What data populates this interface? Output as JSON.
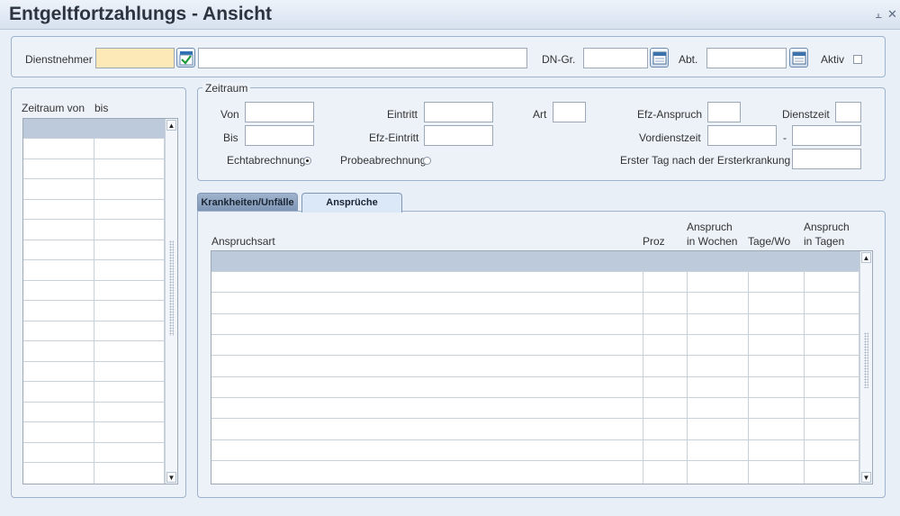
{
  "window": {
    "title": "Entgeltfortzahlungs - Ansicht"
  },
  "header": {
    "dienstnehmer_label": "Dienstnehmer",
    "dienstnehmer_value": "",
    "dienstnehmer_name": "",
    "dngr_label": "DN-Gr.",
    "dngr_value": "",
    "abt_label": "Abt.",
    "abt_value": "",
    "aktiv_label": "Aktiv"
  },
  "left_list": {
    "col1": "Zeitraum von",
    "col2": "bis"
  },
  "zeitraum": {
    "legend": "Zeitraum",
    "von": "Von",
    "bis": "Bis",
    "eintritt": "Eintritt",
    "efz_eintritt": "Efz-Eintritt",
    "art": "Art",
    "efz_anspruch": "Efz-Anspruch",
    "dienstzeit": "Dienstzeit",
    "vordienstzeit": "Vordienstzeit",
    "dash": "-",
    "erster_tag": "Erster Tag nach der Ersterkrankung",
    "echtabrechnung": "Echtabrechnung",
    "probeabrechnung": "Probeabrechnung"
  },
  "tabs": [
    {
      "label": "Krankheiten/Unfälle"
    },
    {
      "label": "Ansprüche"
    }
  ],
  "claims_table": {
    "col_art": "Anspruchsart",
    "col_proz": "Proz",
    "col_wochen_1": "Anspruch",
    "col_wochen_2": "in Wochen",
    "col_tagewo": "Tage/Wo",
    "col_tagen_1": "Anspruch",
    "col_tagen_2": "in Tagen"
  },
  "icons": {
    "ok": "checkmark-icon",
    "calendar": "calendar-icon",
    "minimize": "minimize-icon",
    "close": "close-icon"
  }
}
